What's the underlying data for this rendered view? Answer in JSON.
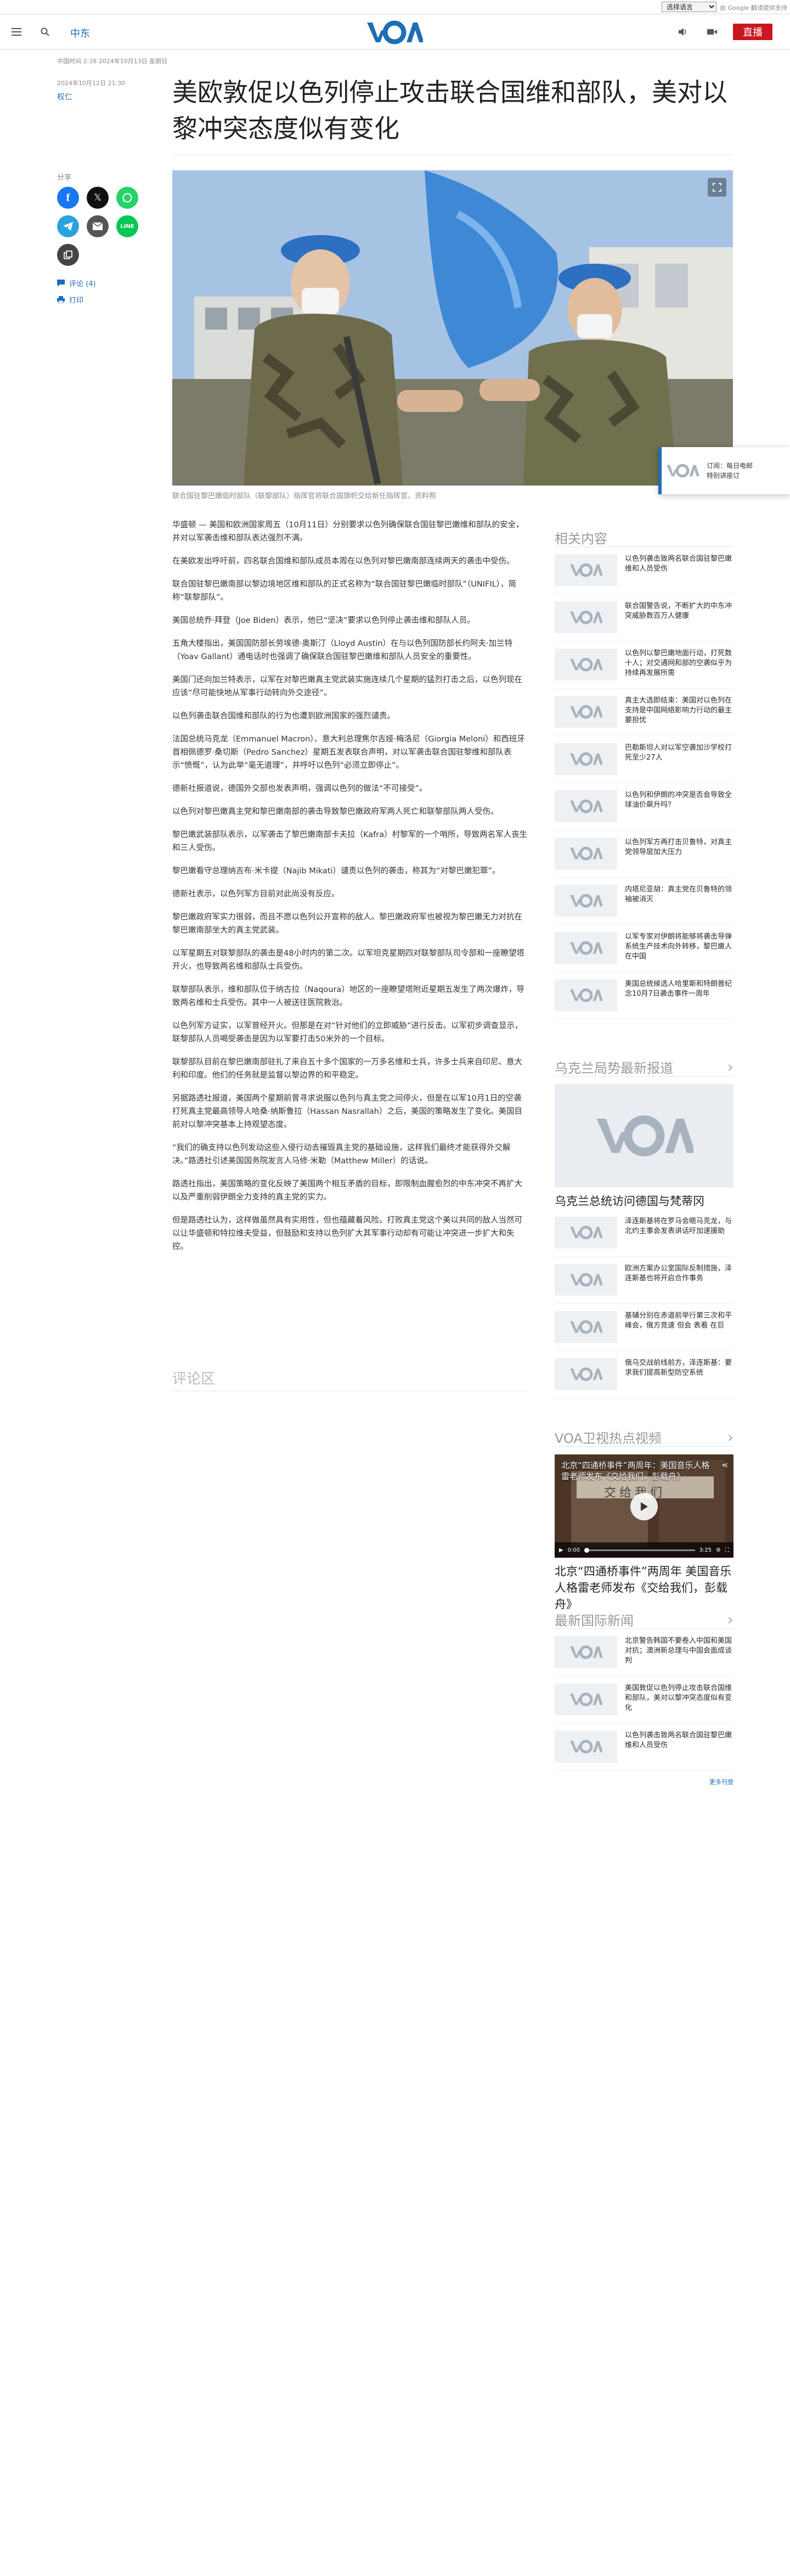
{
  "topbar": {
    "language_select": "选择语言",
    "translate_note": "由 Google 翻译提供支持"
  },
  "header": {
    "region": "中东",
    "logo": "VOA",
    "live": "直播",
    "menu_icon": "menu-icon",
    "search_icon": "search-icon",
    "audio_icon": "audio-icon",
    "video_icon": "video-icon"
  },
  "article": {
    "breadcrumb_time": "中国时间 2:38 2024年10月13日 星期日",
    "published": "2024年10月12日 21:30",
    "byline": "权仁",
    "title": "美欧敦促以色列停止攻击联合国维和部队，美对以黎冲突态度似有变化",
    "share_label": "分享",
    "comments_link": "评论 (4)",
    "print_link": "打印",
    "image_caption": "联合国驻黎巴嫩临时部队（联黎部队）指挥官将联合国旗帜交给新任指挥官。资料照",
    "paragraphs": [
      "华盛顿 — 美国和欧洲国家周五（10月11日）分别要求以色列确保联合国驻黎巴嫩维和部队的安全，并对以军袭击维和部队表达强烈不满。",
      "在美欧发出呼吁前，四名联合国维和部队成员本周在以色列对黎巴嫩南部连续两天的袭击中受伤。",
      "联合国驻黎巴嫩南部以黎边境地区维和部队的正式名称为“联合国驻黎巴嫩临时部队”（UNIFIL），简称“联黎部队”。",
      "美国总统乔·拜登（Joe Biden）表示，他已“坚决”要求以色列停止袭击维和部队人员。",
      "五角大楼指出，美国国防部长劳埃德·奥斯汀（Lloyd Austin）在与以色列国防部长约阿夫·加兰特（Yoav Gallant）通电话时也强调了确保联合国驻黎巴嫩维和部队人员安全的重要性。",
      "美国门还向加兰特表示，以军在对黎巴嫩真主党武装实施连续几个星期的猛烈打击之后，以色列现在应该“尽可能快地从军事行动转向外交途径”。",
      "以色列袭击联合国维和部队的行为也遭到欧洲国家的强烈谴责。",
      "法国总统马克龙（Emmanuel Macron）、意大利总理焦尔吉娅·梅洛尼（Giorgia Meloni）和西班牙首相佩德罗·桑切斯（Pedro Sanchez）星期五发表联合声明，对以军袭击联合国驻黎维和部队表示“愤慨”，认为此举“毫无道理”，并呼吁以色列“必须立即停止”。",
      "德新社报道说，德国外交部也发表声明，强调以色列的做法“不可接受”。",
      "以色列对黎巴嫩真主党和黎巴嫩南部的袭击导致黎巴嫩政府军两人死亡和联黎部队两人受伤。",
      "黎巴嫩武装部队表示，以军袭击了黎巴嫩南部卡夫拉（Kafra）村黎军的一个哨所，导致两名军人丧生和三人受伤。",
      "黎巴嫩看守总理纳吉布·米卡提（Najib Mikati）谴责以色列的袭击，称其为“对黎巴嫩犯罪”。",
      "德新社表示，以色列军方目前对此尚没有反应。",
      "黎巴嫩政府军实力很弱，而且不愿以色列公开宣称的敌人。黎巴嫩政府军也被视为黎巴嫩无力对抗在黎巴嫩南部坐大的真主党武装。",
      "以军星期五对联黎部队的袭击是48小时内的第二次。以军坦克星期四对联黎部队司令部和一座瞭望塔开火，也导致两名维和部队士兵受伤。",
      "联黎部队表示，维和部队位于纳古拉（Naqoura）地区的一座瞭望塔附近星期五发生了两次爆炸，导致两名维和士兵受伤。其中一人被送往医院救治。",
      "以色列军方证实，以军曾经开火。但那是在对“针对他们的立即威胁”进行反击。以军初步调查显示，联黎部队人员喝受袭击是因为以军要打击50米外的一个目标。",
      "联黎部队目前在黎巴嫩南部驻扎了来自五十多个国家的一万多名维和士兵，许多士兵来自印尼、意大利和印度。他们的任务就是监督以黎边界的和平稳定。",
      "另据路透社报道，美国两个星期前曾寻求说服以色列与真主党之间停火，但是在以军10月1日的空袭打死真主党最高领导人哈桑·纳斯鲁拉（Hassan Nasrallah）之后，美国的策略发生了变化。美国目前对以黎冲突基本上持观望态度。",
      "“我们的确支持以色列发动这些入侵行动去摧毁真主党的基础设施，这样我们最终才能获得外交解决。”路透社引述美国国务院发言人马修·米勒（Matthew Miller）的话说。",
      "路透社指出，美国策略的变化反映了美国两个相互矛盾的目标，即限制血腥愈烈的中东冲突不再扩大以及严重削弱伊朗全力支持的真主党的实力。",
      "但是路透社认为，这样做虽然具有实用性，但也蕴藏着风险。打败真主党这个美以共同的敌人当然可以让华盛顿和特拉维夫受益，但鼓励和支持以色列扩大其军事行动却有可能让冲突进一步扩大和失控。"
    ]
  },
  "comments": {
    "heading": "评论区"
  },
  "related": {
    "heading": "相关内容",
    "items": [
      "以色列袭击致两名联合国驻黎巴嫩维和人员受伤",
      "联合国警告说，不断扩大的中东冲突威胁数百万人健康",
      "以色列以黎巴嫩地面行动，打死数十人；对交通网和部的空袭似乎为持续再发展所需",
      "真主大选即结束：美国对以色列在支持是中国网络影响力行动的最主要担忧",
      "巴勒斯坦人对以军空袭加沙学校打死至少27人",
      "以色列和伊朗的冲突是否会导致全球油价飙升吗？",
      "以色列军方再打击贝鲁特，对真主党领导层加大压力",
      "内塔尼亚胡：真主党在贝鲁特的领袖被消灭",
      "以军专家对伊朗将能够将袭击导弹系统生产技术向外转移，黎巴嫩人在中国",
      "美国总统候选人哈里斯和特朗普纪念10月7日袭击事件一周年"
    ]
  },
  "ukraine": {
    "heading": "乌克兰局势最新报道",
    "feature_title": "乌克兰总统访问德国与梵蒂冈",
    "items": [
      "泽连斯基将在罗马会晤马克龙，与北约主事会发表讲话吁加速援助",
      "欧洲方案办公室国际反制措施，泽连斯基也将开启合作事务",
      "基辅分别在赤道前举行第三次和平峰会，俄方竞速 但会 表看 在巨",
      "俄乌交战前线前方，泽连斯基：要求我们提高新型防空系统"
    ]
  },
  "video": {
    "heading": "VOA卫视热点视频",
    "overlay_title": "北京“四通桥事件”两周年：美国音乐人格雷老师发布《交给我们，彭载舟》",
    "overlay_subtitle": "交给我们",
    "time_current": "0:00",
    "time_total": "3:25",
    "caption": "北京“四通桥事件”两周年 美国音乐人格雷老师发布《交给我们，彭载舟》"
  },
  "intl": {
    "heading": "最新国际新闻",
    "items": [
      "北京警告韩国不要卷入中国和美国对抗；澳洲新总理与中国会面成谈判",
      "美国敦促以色列停止攻击联合国维和部队，美对以黎冲突态度似有变化",
      "以色列袭击致两名联合国驻黎巴嫩维和人员受伤"
    ],
    "more_label": "更多刊登"
  },
  "floating": {
    "line1": "订阅：每日电邮",
    "line2": "特别讲座订"
  }
}
